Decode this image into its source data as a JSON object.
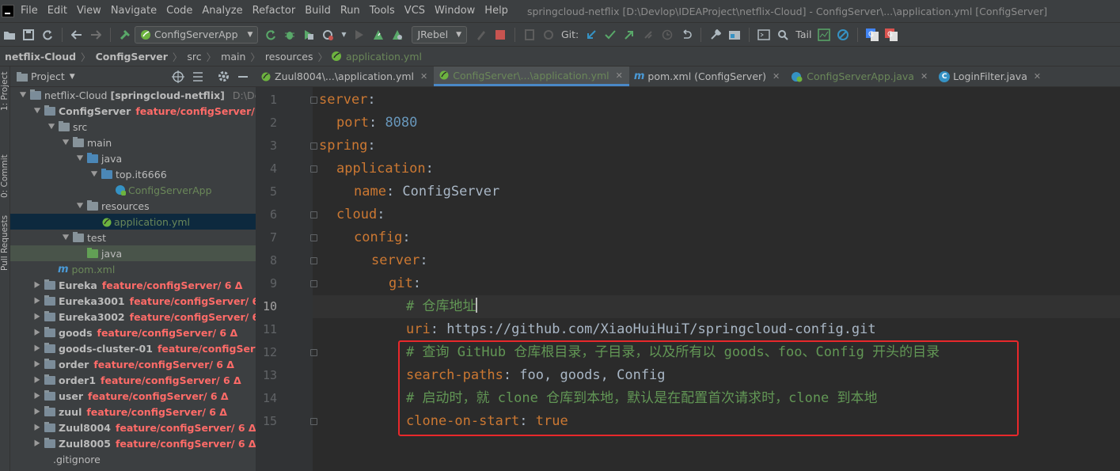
{
  "window": {
    "title": "springcloud-netflix [D:\\Devlop\\IDEAProject\\netflix-Cloud] - ConfigServer\\...\\application.yml [ConfigServer]"
  },
  "menu": [
    "File",
    "Edit",
    "View",
    "Navigate",
    "Code",
    "Analyze",
    "Refactor",
    "Build",
    "Run",
    "Tools",
    "VCS",
    "Window",
    "Help"
  ],
  "toolbar": {
    "run_config": "ConfigServerApp",
    "jrebel": "JRebel",
    "git_label": "Git:",
    "tail_label": "Tail"
  },
  "breadcrumb": [
    "netflix-Cloud",
    "ConfigServer",
    "src",
    "main",
    "resources",
    "application.yml"
  ],
  "side_tabs": {
    "project": "1: Project",
    "commit": "0: Commit",
    "pull_requests": "Pull Requests"
  },
  "project_panel": {
    "title": "Project",
    "tree": [
      {
        "label": "netflix-Cloud",
        "bold_suffix": "[springcloud-netflix]",
        "hint": "D:\\Devlo",
        "depth": 0,
        "kind": "module",
        "expanded": true
      },
      {
        "label": "ConfigServer",
        "branch": "feature/configServer/ 6 Δ",
        "depth": 1,
        "kind": "module",
        "expanded": true
      },
      {
        "label": "src",
        "depth": 2,
        "kind": "folder",
        "expanded": true
      },
      {
        "label": "main",
        "depth": 3,
        "kind": "folder",
        "expanded": true
      },
      {
        "label": "java",
        "depth": 4,
        "kind": "folder-blue",
        "expanded": true
      },
      {
        "label": "top.it6666",
        "depth": 5,
        "kind": "package",
        "expanded": true
      },
      {
        "label": "ConfigServerApp",
        "depth": 6,
        "kind": "spring-class",
        "leaf": true
      },
      {
        "label": "resources",
        "depth": 4,
        "kind": "folder-res",
        "expanded": true
      },
      {
        "label": "application.yml",
        "depth": 5,
        "kind": "yml",
        "leaf": true,
        "selected": true
      },
      {
        "label": "test",
        "depth": 3,
        "kind": "folder",
        "expanded": true
      },
      {
        "label": "java",
        "depth": 4,
        "kind": "folder-green",
        "leaf": true,
        "highlight": true
      },
      {
        "label": "pom.xml",
        "depth": 2,
        "kind": "maven",
        "leaf": true
      },
      {
        "label": "Eureka",
        "branch": "feature/configServer/ 6 Δ",
        "depth": 1,
        "kind": "module",
        "expanded": false
      },
      {
        "label": "Eureka3001",
        "branch": "feature/configServer/ 6 Δ",
        "depth": 1,
        "kind": "module",
        "expanded": false
      },
      {
        "label": "Eureka3002",
        "branch": "feature/configServer/ 6 Δ",
        "depth": 1,
        "kind": "module",
        "expanded": false
      },
      {
        "label": "goods",
        "branch": "feature/configServer/ 6 Δ",
        "depth": 1,
        "kind": "module",
        "expanded": false
      },
      {
        "label": "goods-cluster-01",
        "branch": "feature/configServer/",
        "depth": 1,
        "kind": "module",
        "expanded": false
      },
      {
        "label": "order",
        "branch": "feature/configServer/ 6 Δ",
        "depth": 1,
        "kind": "module",
        "expanded": false
      },
      {
        "label": "order1",
        "branch": "feature/configServer/ 6 Δ",
        "depth": 1,
        "kind": "module",
        "expanded": false
      },
      {
        "label": "user",
        "branch": "feature/configServer/ 6 Δ",
        "depth": 1,
        "kind": "module",
        "expanded": false
      },
      {
        "label": "zuul",
        "branch": "feature/configServer/ 6 Δ",
        "depth": 1,
        "kind": "module",
        "expanded": false
      },
      {
        "label": "Zuul8004",
        "branch": "feature/configServer/ 6 Δ",
        "depth": 1,
        "kind": "module",
        "expanded": false
      },
      {
        "label": "Zuul8005",
        "branch": "feature/configServer/ 6 Δ",
        "depth": 1,
        "kind": "module",
        "expanded": false
      },
      {
        "label": ".gitignore",
        "depth": 1,
        "kind": "file",
        "leaf": true
      }
    ]
  },
  "editor_tabs": [
    {
      "label": "Zuul8004\\...\\application.yml",
      "icon": "yml",
      "active": false
    },
    {
      "label": "ConfigServer\\...\\application.yml",
      "icon": "yml",
      "active": true
    },
    {
      "label": "pom.xml (ConfigServer)",
      "icon": "maven",
      "active": false
    },
    {
      "label": "ConfigServerApp.java",
      "icon": "spring-class",
      "active": false
    },
    {
      "label": "LoginFilter.java",
      "icon": "class",
      "active": false
    }
  ],
  "editor": {
    "current_line": 10,
    "lines": [
      {
        "num": "1",
        "indent": 0,
        "parts": [
          {
            "t": "server",
            "c": "k"
          },
          {
            "t": ":",
            "c": "v"
          }
        ]
      },
      {
        "num": "2",
        "indent": 1,
        "parts": [
          {
            "t": "port",
            "c": "k"
          },
          {
            "t": ": ",
            "c": "v"
          },
          {
            "t": "8080",
            "c": "n"
          }
        ]
      },
      {
        "num": "3",
        "indent": 0,
        "parts": [
          {
            "t": "spring",
            "c": "k"
          },
          {
            "t": ":",
            "c": "v"
          }
        ]
      },
      {
        "num": "4",
        "indent": 1,
        "parts": [
          {
            "t": "application",
            "c": "k"
          },
          {
            "t": ":",
            "c": "v"
          }
        ]
      },
      {
        "num": "5",
        "indent": 2,
        "parts": [
          {
            "t": "name",
            "c": "k"
          },
          {
            "t": ": ConfigServer",
            "c": "v"
          }
        ]
      },
      {
        "num": "6",
        "indent": 1,
        "parts": [
          {
            "t": "cloud",
            "c": "k"
          },
          {
            "t": ":",
            "c": "v"
          }
        ]
      },
      {
        "num": "7",
        "indent": 2,
        "parts": [
          {
            "t": "config",
            "c": "k"
          },
          {
            "t": ":",
            "c": "v"
          }
        ]
      },
      {
        "num": "8",
        "indent": 3,
        "parts": [
          {
            "t": "server",
            "c": "k"
          },
          {
            "t": ":",
            "c": "v"
          }
        ]
      },
      {
        "num": "9",
        "indent": 4,
        "parts": [
          {
            "t": "git",
            "c": "k"
          },
          {
            "t": ":",
            "c": "v"
          }
        ]
      },
      {
        "num": "10",
        "indent": 5,
        "parts": [
          {
            "t": "# 仓库地址",
            "c": "c"
          }
        ]
      },
      {
        "num": "11",
        "indent": 5,
        "parts": [
          {
            "t": "uri",
            "c": "k"
          },
          {
            "t": ": https://github.com/XiaoHuiHuiT/springcloud-config.git",
            "c": "v"
          }
        ]
      },
      {
        "num": "12",
        "indent": 5,
        "parts": [
          {
            "t": "# 查询 GitHub 仓库根目录，子目录，以及所有以 goods、foo、Config 开头的目录",
            "c": "c"
          }
        ]
      },
      {
        "num": "13",
        "indent": 5,
        "parts": [
          {
            "t": "search-paths",
            "c": "k"
          },
          {
            "t": ": foo, goods, Config",
            "c": "v"
          }
        ]
      },
      {
        "num": "14",
        "indent": 5,
        "parts": [
          {
            "t": "# 启动时，就 clone 仓库到本地，默认是在配置首次请求时，clone 到本地",
            "c": "c"
          }
        ]
      },
      {
        "num": "15",
        "indent": 5,
        "parts": [
          {
            "t": "clone-on-start",
            "c": "k"
          },
          {
            "t": ": ",
            "c": "v"
          },
          {
            "t": "true",
            "c": "k"
          }
        ]
      }
    ]
  },
  "colors": {
    "keyword": "#cc7832",
    "comment": "#629755",
    "number": "#6897bb",
    "text": "#a9b7c6",
    "branch": "#ff6b68",
    "highlight_box": "#e8282b"
  }
}
